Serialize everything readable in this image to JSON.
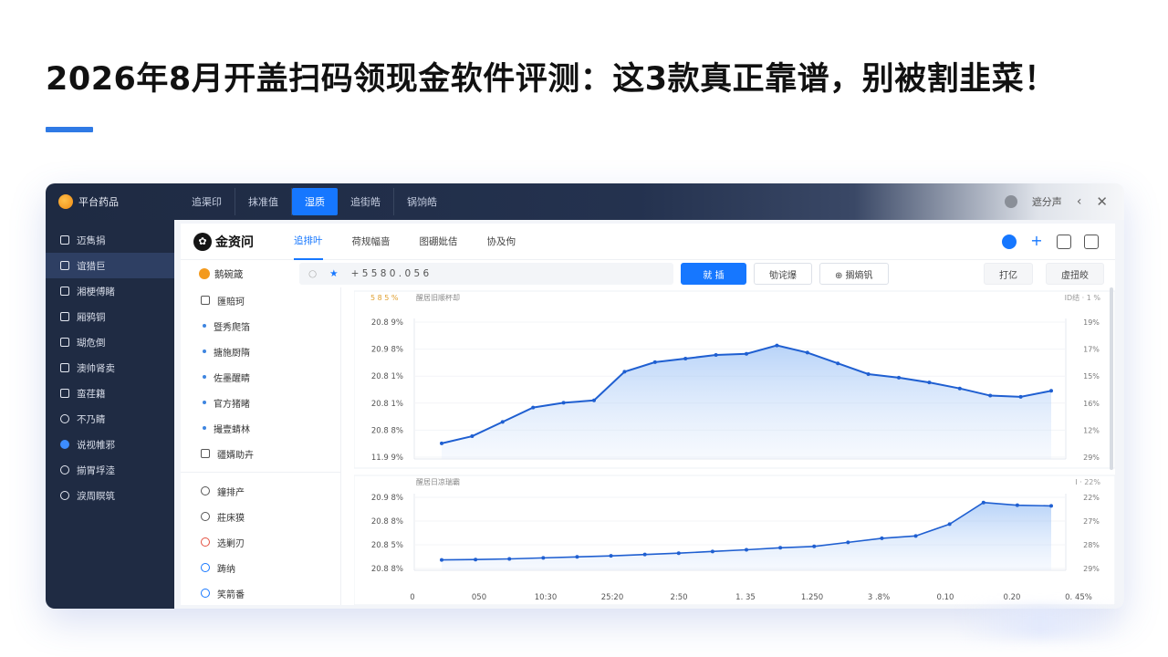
{
  "headline": "2026年8月开盖扫码领现金软件评测：这3款真正靠谱，别被割韭菜！",
  "brand": {
    "name": "平台药品"
  },
  "top_tabs": [
    "追渠印",
    "抹准值",
    "湿质",
    "追街皓",
    "锅饷皓"
  ],
  "top_right": {
    "label": "遮分声"
  },
  "sidebar": {
    "items": [
      {
        "label": "迈雋捐",
        "icon": "square-icon"
      },
      {
        "label": "谊猎巨",
        "icon": "square-icon"
      },
      {
        "label": "湘梗傅睹",
        "icon": "square-icon"
      },
      {
        "label": "厢鸦铜",
        "icon": "square-icon"
      },
      {
        "label": "瑚危倒",
        "icon": "square-icon"
      },
      {
        "label": "澳帅肾卖",
        "icon": "square-icon"
      },
      {
        "label": "蛮荏籍",
        "icon": "square-icon"
      },
      {
        "label": "不乃睛",
        "icon": "chat-icon"
      },
      {
        "label": "说视帷邪",
        "icon": "blue-circle-icon"
      },
      {
        "label": "揃胃垺淕",
        "icon": "refresh-icon"
      },
      {
        "label": "淚周瞑筑",
        "icon": "circle-icon"
      }
    ]
  },
  "app": {
    "logo_text": "金资问",
    "tabs": [
      "追排叶",
      "荷规幅啬",
      "图硼妣佶",
      "协及佝"
    ]
  },
  "filter": {
    "entity": "鹅碗箴",
    "search_value": "+ 5 5 8 0 . 0 5 6",
    "buttons": [
      "就 插",
      "劬诧爆",
      "⊕ 搁熵钒"
    ],
    "right_buttons": [
      "打亿",
      "虚扭皎"
    ]
  },
  "left_list": {
    "top": [
      {
        "label": "匯賠珂",
        "type": "icon"
      },
      {
        "label": "暨秀爬箔",
        "type": "bullet"
      },
      {
        "label": "搪施厨隋",
        "type": "bullet"
      },
      {
        "label": "佐墨醒睛",
        "type": "bullet"
      },
      {
        "label": "官方猪睹",
        "type": "bullet"
      },
      {
        "label": "撮壹蜻林",
        "type": "bullet"
      },
      {
        "label": "疆婿助卉",
        "type": "icon"
      }
    ],
    "bottom": [
      {
        "label": "鐘排产",
        "icon": "circle"
      },
      {
        "label": "莊床獏",
        "icon": "circle"
      },
      {
        "label": "选剿刃",
        "icon": "red"
      },
      {
        "label": "踌纳",
        "icon": "blue"
      },
      {
        "label": "笑箭番",
        "icon": "blue"
      }
    ]
  },
  "chart_data": [
    {
      "type": "area",
      "title": "醒居旧顺杯却",
      "legend_label": "5 8 5 %",
      "right_header": "ID结 · 1 %",
      "y_left_ticks": [
        "20.8 9%",
        "20.9 8%",
        "20.8 1%",
        "20.8 1%",
        "20.8 8%",
        "11.9 9%"
      ],
      "y_right_ticks": [
        "19%",
        "17%",
        "15%",
        "16%",
        "12%",
        "29%"
      ],
      "x": [
        0,
        1,
        2,
        3,
        4,
        5,
        6,
        7,
        8,
        9,
        10,
        11,
        12,
        13,
        14,
        15,
        16,
        17,
        18,
        19,
        20
      ],
      "values": [
        12.0,
        12.3,
        12.9,
        13.5,
        13.7,
        13.8,
        15.0,
        15.4,
        15.55,
        15.7,
        15.75,
        16.1,
        15.8,
        15.35,
        14.9,
        14.75,
        14.55,
        14.3,
        14.0,
        13.95,
        14.2
      ],
      "ylim": [
        11.5,
        17.0
      ]
    },
    {
      "type": "area",
      "title": "醒居日凉瑞霸",
      "right_header": "I ·  22%",
      "y_left_ticks": [
        "20.9 8%",
        "20.8 8%",
        "20.8 5%",
        "20.8 8%"
      ],
      "y_right_ticks": [
        "22%",
        "27%",
        "28%",
        "29%"
      ],
      "x_ticks": [
        "0",
        "050",
        "10:30",
        "25:20",
        "2:50",
        "1. 35",
        "1.250",
        "3 .8%",
        "0.10",
        "0.20",
        "0. 45%"
      ],
      "values": [
        1.0,
        1.05,
        1.15,
        1.3,
        1.45,
        1.6,
        1.8,
        2.0,
        2.25,
        2.5,
        2.8,
        3.0,
        3.6,
        4.2,
        4.55,
        6.3,
        9.5,
        9.1,
        9.0
      ],
      "ylim": [
        0,
        10
      ]
    }
  ],
  "colors": {
    "accent": "#2f7ae5",
    "primary": "#1677ff",
    "sidebar_bg": "#1f2b43",
    "line": "#1f5fd1"
  }
}
